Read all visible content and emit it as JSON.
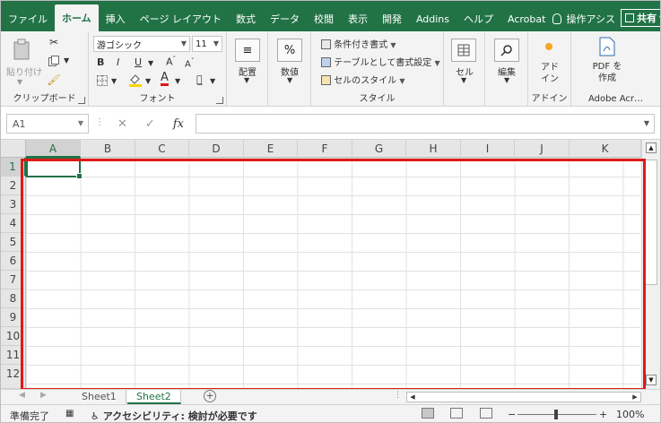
{
  "tabs": [
    "ファイル",
    "ホーム",
    "挿入",
    "ページ レイアウト",
    "数式",
    "データ",
    "校閲",
    "表示",
    "開発",
    "Addins",
    "ヘルプ",
    "Acrobat"
  ],
  "active_tab_index": 1,
  "tell_me": "操作アシス",
  "share_label": "共有",
  "ribbon": {
    "clipboard": {
      "paste_label": "貼り付け",
      "group_label": "クリップボード"
    },
    "font": {
      "font_name": "游ゴシック",
      "font_size": "11",
      "group_label": "フォント",
      "bold": "B",
      "italic": "I",
      "underline": "U"
    },
    "alignment": {
      "label": "配置"
    },
    "number": {
      "label": "数値"
    },
    "styles": {
      "conditional": "条件付き書式",
      "table": "テーブルとして書式設定",
      "cell_styles": "セルのスタイル",
      "group_label": "スタイル"
    },
    "cells": {
      "label": "セル"
    },
    "editing": {
      "label": "編集"
    },
    "addins": {
      "label": "アド イン",
      "group_label": "アドイン"
    },
    "adobe": {
      "label": "PDF を作成",
      "group_label": "Adobe Acr…"
    }
  },
  "name_box": "A1",
  "formula_value": "",
  "columns": [
    "A",
    "B",
    "C",
    "D",
    "E",
    "F",
    "G",
    "H",
    "I",
    "J",
    "K"
  ],
  "rows": [
    "1",
    "2",
    "3",
    "4",
    "5",
    "6",
    "7",
    "8",
    "9",
    "10",
    "11",
    "12"
  ],
  "active_cell": "A1",
  "sheets": [
    "Sheet1",
    "Sheet2"
  ],
  "active_sheet_index": 1,
  "status": {
    "ready": "準備完了",
    "accessibility": "アクセシビリティ: 検討が必要です",
    "zoom": "100%"
  },
  "colors": {
    "accent": "#217346",
    "highlight": "#e01919"
  }
}
